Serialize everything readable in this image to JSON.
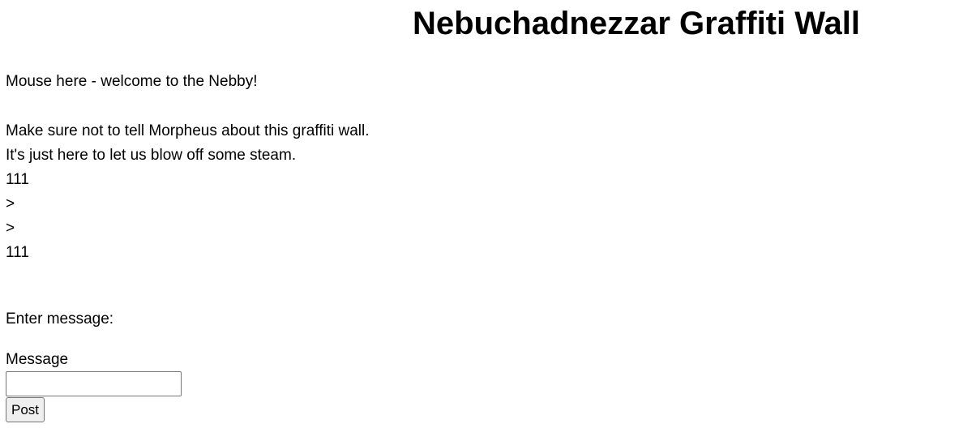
{
  "page": {
    "title": "Nebuchadnezzar Graffiti Wall",
    "intro": "Mouse here - welcome to the Nebby!",
    "warning_lines": [
      "Make sure not to tell Morpheus about this graffiti wall.",
      "It's just here to let us blow off some steam."
    ],
    "posts": [
      "111",
      ">",
      ">",
      "111"
    ]
  },
  "form": {
    "heading": "Enter message:",
    "message_label": "Message",
    "message_value": "",
    "post_button": "Post"
  }
}
